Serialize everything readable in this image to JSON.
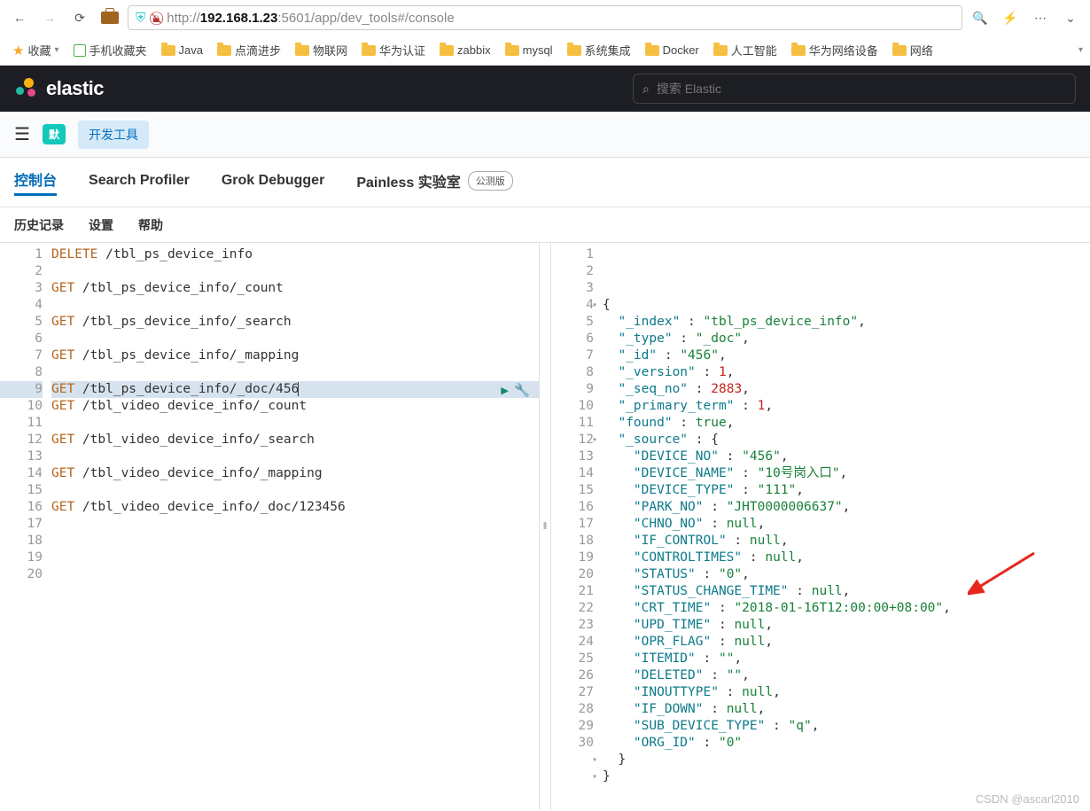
{
  "browser": {
    "url_prefix": "http://",
    "url_host": "192.168.1.23",
    "url_rest": ":5601/app/dev_tools#/console"
  },
  "bookmarks": {
    "fav": "收藏",
    "mobile": "手机收藏夹",
    "items": [
      "Java",
      "点滴进步",
      "物联网",
      "华为认证",
      "zabbix",
      "mysql",
      "系统集成",
      "Docker",
      "人工智能",
      "华为网络设备",
      "网络"
    ]
  },
  "header": {
    "brand": "elastic",
    "search_placeholder": "搜索 Elastic"
  },
  "subheader": {
    "badge_default": "默",
    "badge_dev": "开发工具"
  },
  "tabs": {
    "console": "控制台",
    "profiler": "Search Profiler",
    "grok": "Grok Debugger",
    "painless": "Painless 实验室",
    "beta": "公测版"
  },
  "subtabs": {
    "history": "历史记录",
    "settings": "设置",
    "help": "帮助"
  },
  "left_editor": {
    "active_line": 9,
    "lines": [
      {
        "n": 1,
        "t": [
          {
            "c": "kw",
            "v": "DELETE "
          },
          {
            "c": "",
            "v": "/tbl_ps_device_info"
          }
        ]
      },
      {
        "n": 2,
        "t": []
      },
      {
        "n": 3,
        "t": [
          {
            "c": "kw",
            "v": "GET "
          },
          {
            "c": "",
            "v": "/tbl_ps_device_info/_count"
          }
        ]
      },
      {
        "n": 4,
        "t": []
      },
      {
        "n": 5,
        "t": [
          {
            "c": "kw",
            "v": "GET "
          },
          {
            "c": "",
            "v": "/tbl_ps_device_info/_search"
          }
        ]
      },
      {
        "n": 6,
        "t": []
      },
      {
        "n": 7,
        "t": [
          {
            "c": "kw",
            "v": "GET "
          },
          {
            "c": "",
            "v": "/tbl_ps_device_info/_mapping"
          }
        ]
      },
      {
        "n": 8,
        "t": []
      },
      {
        "n": 9,
        "hl": true,
        "t": [
          {
            "c": "kw",
            "v": "GET "
          },
          {
            "c": "",
            "v": "/tbl_ps_device_info/_doc/456"
          }
        ],
        "cursor": true,
        "actions": true
      },
      {
        "n": 10,
        "t": [
          {
            "c": "kw",
            "v": "GET "
          },
          {
            "c": "",
            "v": "/tbl_video_device_info/_count"
          }
        ]
      },
      {
        "n": 11,
        "t": []
      },
      {
        "n": 12,
        "t": [
          {
            "c": "kw",
            "v": "GET "
          },
          {
            "c": "",
            "v": "/tbl_video_device_info/_search"
          }
        ]
      },
      {
        "n": 13,
        "t": []
      },
      {
        "n": 14,
        "t": [
          {
            "c": "kw",
            "v": "GET "
          },
          {
            "c": "",
            "v": "/tbl_video_device_info/_mapping"
          }
        ]
      },
      {
        "n": 15,
        "t": []
      },
      {
        "n": 16,
        "t": [
          {
            "c": "kw",
            "v": "GET "
          },
          {
            "c": "",
            "v": "/tbl_video_device_info/_doc/123456"
          }
        ]
      },
      {
        "n": 17,
        "t": []
      },
      {
        "n": 18,
        "t": []
      },
      {
        "n": 19,
        "t": []
      },
      {
        "n": 20,
        "t": []
      }
    ]
  },
  "right_editor": {
    "lines": [
      {
        "n": 1,
        "fold": true,
        "t": [
          {
            "c": "pun",
            "v": "{"
          }
        ]
      },
      {
        "n": 2,
        "t": [
          {
            "c": "",
            "v": "  "
          },
          {
            "c": "key",
            "v": "\"_index\""
          },
          {
            "c": "pun",
            "v": " : "
          },
          {
            "c": "str",
            "v": "\"tbl_ps_device_info\""
          },
          {
            "c": "pun",
            "v": ","
          }
        ]
      },
      {
        "n": 3,
        "t": [
          {
            "c": "",
            "v": "  "
          },
          {
            "c": "key",
            "v": "\"_type\""
          },
          {
            "c": "pun",
            "v": " : "
          },
          {
            "c": "str",
            "v": "\"_doc\""
          },
          {
            "c": "pun",
            "v": ","
          }
        ]
      },
      {
        "n": 4,
        "t": [
          {
            "c": "",
            "v": "  "
          },
          {
            "c": "key",
            "v": "\"_id\""
          },
          {
            "c": "pun",
            "v": " : "
          },
          {
            "c": "str",
            "v": "\"456\""
          },
          {
            "c": "pun",
            "v": ","
          }
        ]
      },
      {
        "n": 5,
        "t": [
          {
            "c": "",
            "v": "  "
          },
          {
            "c": "key",
            "v": "\"_version\""
          },
          {
            "c": "pun",
            "v": " : "
          },
          {
            "c": "num",
            "v": "1"
          },
          {
            "c": "pun",
            "v": ","
          }
        ]
      },
      {
        "n": 6,
        "t": [
          {
            "c": "",
            "v": "  "
          },
          {
            "c": "key",
            "v": "\"_seq_no\""
          },
          {
            "c": "pun",
            "v": " : "
          },
          {
            "c": "num",
            "v": "2883"
          },
          {
            "c": "pun",
            "v": ","
          }
        ]
      },
      {
        "n": 7,
        "t": [
          {
            "c": "",
            "v": "  "
          },
          {
            "c": "key",
            "v": "\"_primary_term\""
          },
          {
            "c": "pun",
            "v": " : "
          },
          {
            "c": "num",
            "v": "1"
          },
          {
            "c": "pun",
            "v": ","
          }
        ]
      },
      {
        "n": 8,
        "t": [
          {
            "c": "",
            "v": "  "
          },
          {
            "c": "key",
            "v": "\"found\""
          },
          {
            "c": "pun",
            "v": " : "
          },
          {
            "c": "null",
            "v": "true"
          },
          {
            "c": "pun",
            "v": ","
          }
        ]
      },
      {
        "n": 9,
        "fold": true,
        "t": [
          {
            "c": "",
            "v": "  "
          },
          {
            "c": "key",
            "v": "\"_source\""
          },
          {
            "c": "pun",
            "v": " : {"
          }
        ]
      },
      {
        "n": 10,
        "t": [
          {
            "c": "",
            "v": "    "
          },
          {
            "c": "key",
            "v": "\"DEVICE_NO\""
          },
          {
            "c": "pun",
            "v": " : "
          },
          {
            "c": "str",
            "v": "\"456\""
          },
          {
            "c": "pun",
            "v": ","
          }
        ]
      },
      {
        "n": 11,
        "t": [
          {
            "c": "",
            "v": "    "
          },
          {
            "c": "key",
            "v": "\"DEVICE_NAME\""
          },
          {
            "c": "pun",
            "v": " : "
          },
          {
            "c": "str",
            "v": "\"10号岗入口\""
          },
          {
            "c": "pun",
            "v": ","
          }
        ]
      },
      {
        "n": 12,
        "t": [
          {
            "c": "",
            "v": "    "
          },
          {
            "c": "key",
            "v": "\"DEVICE_TYPE\""
          },
          {
            "c": "pun",
            "v": " : "
          },
          {
            "c": "str",
            "v": "\"111\""
          },
          {
            "c": "pun",
            "v": ","
          }
        ]
      },
      {
        "n": 13,
        "t": [
          {
            "c": "",
            "v": "    "
          },
          {
            "c": "key",
            "v": "\"PARK_NO\""
          },
          {
            "c": "pun",
            "v": " : "
          },
          {
            "c": "str",
            "v": "\"JHT0000006637\""
          },
          {
            "c": "pun",
            "v": ","
          }
        ]
      },
      {
        "n": 14,
        "t": [
          {
            "c": "",
            "v": "    "
          },
          {
            "c": "key",
            "v": "\"CHNO_NO\""
          },
          {
            "c": "pun",
            "v": " : "
          },
          {
            "c": "null",
            "v": "null"
          },
          {
            "c": "pun",
            "v": ","
          }
        ]
      },
      {
        "n": 15,
        "t": [
          {
            "c": "",
            "v": "    "
          },
          {
            "c": "key",
            "v": "\"IF_CONTROL\""
          },
          {
            "c": "pun",
            "v": " : "
          },
          {
            "c": "null",
            "v": "null"
          },
          {
            "c": "pun",
            "v": ","
          }
        ]
      },
      {
        "n": 16,
        "t": [
          {
            "c": "",
            "v": "    "
          },
          {
            "c": "key",
            "v": "\"CONTROLTIMES\""
          },
          {
            "c": "pun",
            "v": " : "
          },
          {
            "c": "null",
            "v": "null"
          },
          {
            "c": "pun",
            "v": ","
          }
        ]
      },
      {
        "n": 17,
        "t": [
          {
            "c": "",
            "v": "    "
          },
          {
            "c": "key",
            "v": "\"STATUS\""
          },
          {
            "c": "pun",
            "v": " : "
          },
          {
            "c": "str",
            "v": "\"0\""
          },
          {
            "c": "pun",
            "v": ","
          }
        ]
      },
      {
        "n": 18,
        "t": [
          {
            "c": "",
            "v": "    "
          },
          {
            "c": "key",
            "v": "\"STATUS_CHANGE_TIME\""
          },
          {
            "c": "pun",
            "v": " : "
          },
          {
            "c": "null",
            "v": "null"
          },
          {
            "c": "pun",
            "v": ","
          }
        ]
      },
      {
        "n": 19,
        "t": [
          {
            "c": "",
            "v": "    "
          },
          {
            "c": "key",
            "v": "\"CRT_TIME\""
          },
          {
            "c": "pun",
            "v": " : "
          },
          {
            "c": "str",
            "v": "\"2018-01-16T12:00:00+08:00\""
          },
          {
            "c": "pun",
            "v": ","
          }
        ]
      },
      {
        "n": 20,
        "t": [
          {
            "c": "",
            "v": "    "
          },
          {
            "c": "key",
            "v": "\"UPD_TIME\""
          },
          {
            "c": "pun",
            "v": " : "
          },
          {
            "c": "null",
            "v": "null"
          },
          {
            "c": "pun",
            "v": ","
          }
        ]
      },
      {
        "n": 21,
        "t": [
          {
            "c": "",
            "v": "    "
          },
          {
            "c": "key",
            "v": "\"OPR_FLAG\""
          },
          {
            "c": "pun",
            "v": " : "
          },
          {
            "c": "null",
            "v": "null"
          },
          {
            "c": "pun",
            "v": ","
          }
        ]
      },
      {
        "n": 22,
        "t": [
          {
            "c": "",
            "v": "    "
          },
          {
            "c": "key",
            "v": "\"ITEMID\""
          },
          {
            "c": "pun",
            "v": " : "
          },
          {
            "c": "str",
            "v": "\"\""
          },
          {
            "c": "pun",
            "v": ","
          }
        ]
      },
      {
        "n": 23,
        "t": [
          {
            "c": "",
            "v": "    "
          },
          {
            "c": "key",
            "v": "\"DELETED\""
          },
          {
            "c": "pun",
            "v": " : "
          },
          {
            "c": "str",
            "v": "\"\""
          },
          {
            "c": "pun",
            "v": ","
          }
        ]
      },
      {
        "n": 24,
        "t": [
          {
            "c": "",
            "v": "    "
          },
          {
            "c": "key",
            "v": "\"INOUTTYPE\""
          },
          {
            "c": "pun",
            "v": " : "
          },
          {
            "c": "null",
            "v": "null"
          },
          {
            "c": "pun",
            "v": ","
          }
        ]
      },
      {
        "n": 25,
        "t": [
          {
            "c": "",
            "v": "    "
          },
          {
            "c": "key",
            "v": "\"IF_DOWN\""
          },
          {
            "c": "pun",
            "v": " : "
          },
          {
            "c": "null",
            "v": "null"
          },
          {
            "c": "pun",
            "v": ","
          }
        ]
      },
      {
        "n": 26,
        "t": [
          {
            "c": "",
            "v": "    "
          },
          {
            "c": "key",
            "v": "\"SUB_DEVICE_TYPE\""
          },
          {
            "c": "pun",
            "v": " : "
          },
          {
            "c": "str",
            "v": "\"q\""
          },
          {
            "c": "pun",
            "v": ","
          }
        ]
      },
      {
        "n": 27,
        "t": [
          {
            "c": "",
            "v": "    "
          },
          {
            "c": "key",
            "v": "\"ORG_ID\""
          },
          {
            "c": "pun",
            "v": " : "
          },
          {
            "c": "str",
            "v": "\"0\""
          }
        ]
      },
      {
        "n": 28,
        "fold": true,
        "t": [
          {
            "c": "",
            "v": "  "
          },
          {
            "c": "pun",
            "v": "}"
          }
        ]
      },
      {
        "n": 29,
        "fold": true,
        "t": [
          {
            "c": "pun",
            "v": "}"
          }
        ]
      },
      {
        "n": 30,
        "t": []
      }
    ]
  },
  "watermark": "CSDN @ascarl2010"
}
